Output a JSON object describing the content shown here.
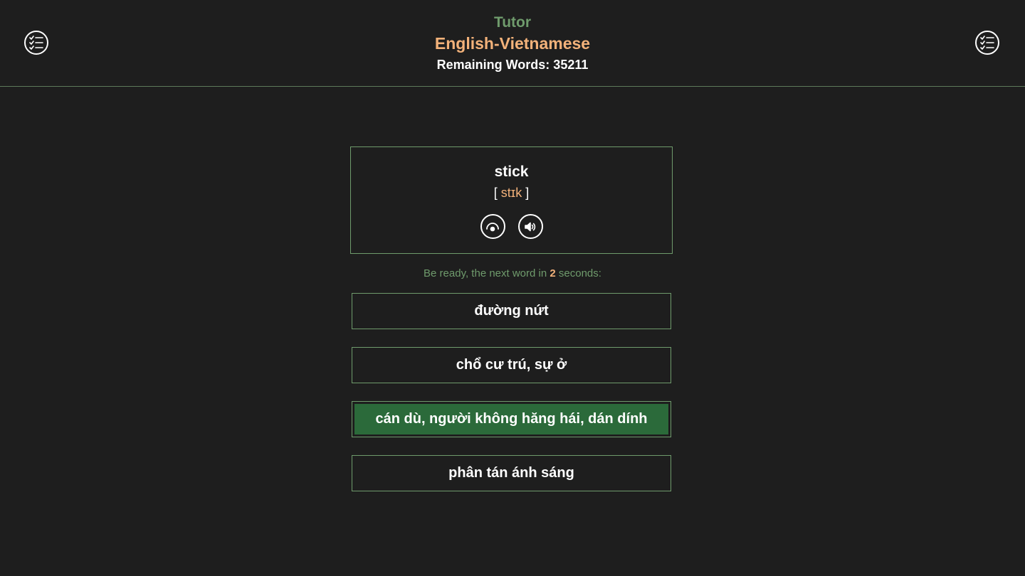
{
  "header": {
    "app_title": "Tutor",
    "pair_title": "English-Vietnamese",
    "remaining_label": "Remaining Words: 35211",
    "left_menu_icon": "checklist-icon",
    "right_menu_icon": "checklist-icon"
  },
  "card": {
    "word": "stick",
    "phonetic_open": "[ ",
    "phonetic": "stɪk",
    "phonetic_close": " ]",
    "reveal_icon": "eye-icon",
    "speaker_icon": "speaker-icon"
  },
  "countdown": {
    "prefix": "Be ready, the next word in ",
    "seconds": "2",
    "suffix": " seconds:"
  },
  "answers": [
    {
      "label": "đường nứt",
      "correct": false
    },
    {
      "label": "chổ cư trú, sự ở",
      "correct": false
    },
    {
      "label": "cán dù, người không hăng hái, dán dính",
      "correct": true
    },
    {
      "label": "phân tán ánh sáng",
      "correct": false
    }
  ],
  "colors": {
    "background": "#1e1e1e",
    "accent_green": "#6f9b6c",
    "accent_orange": "#f3b27a",
    "correct_fill": "#2b6a3a"
  }
}
